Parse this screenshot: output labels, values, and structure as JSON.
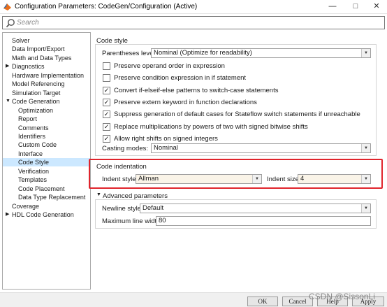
{
  "window": {
    "title": "Configuration Parameters: CodeGen/Configuration (Active)",
    "minimize": "—",
    "maximize": "□",
    "close": "✕"
  },
  "search": {
    "placeholder": "Search"
  },
  "tree": {
    "items": [
      {
        "label": "Solver"
      },
      {
        "label": "Data Import/Export"
      },
      {
        "label": "Math and Data Types"
      },
      {
        "label": "Diagnostics",
        "arrow": "▶"
      },
      {
        "label": "Hardware Implementation"
      },
      {
        "label": "Model Referencing"
      },
      {
        "label": "Simulation Target"
      },
      {
        "label": "Code Generation",
        "arrow": "▼"
      },
      {
        "label": "Optimization"
      },
      {
        "label": "Report"
      },
      {
        "label": "Comments"
      },
      {
        "label": "Identifiers"
      },
      {
        "label": "Custom Code"
      },
      {
        "label": "Interface"
      },
      {
        "label": "Code Style",
        "selected": true
      },
      {
        "label": "Verification"
      },
      {
        "label": "Templates"
      },
      {
        "label": "Code Placement"
      },
      {
        "label": "Data Type Replacement"
      },
      {
        "label": "Coverage"
      },
      {
        "label": "HDL Code Generation",
        "arrow": "▶"
      }
    ]
  },
  "code_style": {
    "title": "Code style",
    "parentheses_label": "Parentheses level:",
    "parentheses_value": "Nominal (Optimize for readability)",
    "checkboxes": [
      {
        "label": "Preserve operand order in expression",
        "checked": false
      },
      {
        "label": "Preserve condition expression in if statement",
        "checked": false
      },
      {
        "label": "Convert if-elseif-else patterns to switch-case statements",
        "checked": true
      },
      {
        "label": "Preserve extern keyword in function declarations",
        "checked": true
      },
      {
        "label": "Suppress generation of default cases for Stateflow switch statements if unreachable",
        "checked": true
      },
      {
        "label": "Replace multiplications by powers of two with signed bitwise shifts",
        "checked": true
      },
      {
        "label": "Allow right shifts on signed integers",
        "checked": true
      }
    ],
    "casting_label": "Casting modes:",
    "casting_value": "Nominal"
  },
  "code_indentation": {
    "title": "Code indentation",
    "indent_style_label": "Indent style:",
    "indent_style_value": "Allman",
    "indent_size_label": "Indent size:",
    "indent_size_value": "4"
  },
  "advanced": {
    "title": "Advanced parameters",
    "newline_label": "Newline style:",
    "newline_value": "Default",
    "max_width_label": "Maximum line width:",
    "max_width_value": "80"
  },
  "footer": {
    "ok": "OK",
    "cancel": "Cancel",
    "help": "Help",
    "apply": "Apply",
    "watermark": "CSDN @SissonLi"
  },
  "colors": {
    "selection": "#cce8ff",
    "highlight_border": "#e0242c",
    "dropdown_tan": "#faf4e8"
  }
}
